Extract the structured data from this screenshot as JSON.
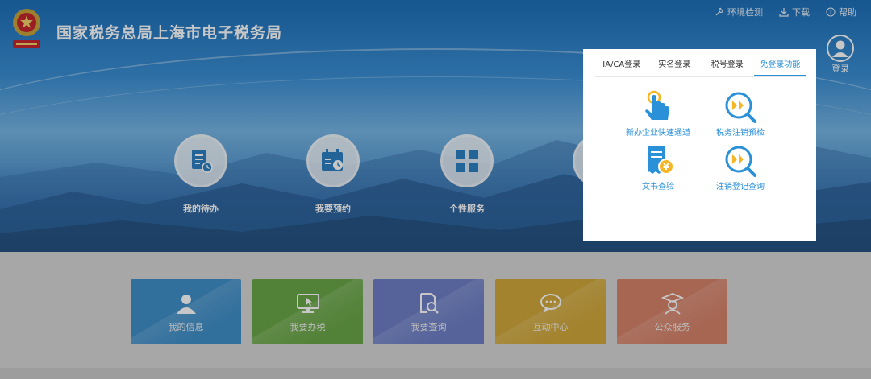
{
  "header": {
    "title": "国家税务总局上海市电子税务局",
    "logo_icon": "tax-bureau-emblem",
    "top_links": [
      {
        "label": "环境检测",
        "icon": "wrench-icon"
      },
      {
        "label": "下载",
        "icon": "download-icon"
      },
      {
        "label": "帮助",
        "icon": "help-icon"
      }
    ],
    "login_label": "登录"
  },
  "quick_entries": [
    {
      "label": "我的待办",
      "icon": "todo-doc-icon"
    },
    {
      "label": "我要预约",
      "icon": "calendar-icon"
    },
    {
      "label": "个性服务",
      "icon": "grid-icon"
    }
  ],
  "service_cards": [
    {
      "label": "我的信息",
      "icon": "user-icon",
      "color": "#3f8fc9"
    },
    {
      "label": "我要办税",
      "icon": "monitor-icon",
      "color": "#6aa747"
    },
    {
      "label": "我要查询",
      "icon": "search-doc-icon",
      "color": "#6d7fc6"
    },
    {
      "label": "互动中心",
      "icon": "chat-icon",
      "color": "#d1a83a"
    },
    {
      "label": "公众服务",
      "icon": "graduate-icon",
      "color": "#d6836a"
    }
  ],
  "login_panel": {
    "tabs": [
      {
        "label": "IA/CA登录",
        "active": false
      },
      {
        "label": "实名登录",
        "active": false
      },
      {
        "label": "税号登录",
        "active": false
      },
      {
        "label": "免登录功能",
        "active": true
      }
    ],
    "features": [
      {
        "label": "新办企业快速通道",
        "icon": "tap-hand-icon"
      },
      {
        "label": "税务注销预检",
        "icon": "magnifier-forward-icon"
      },
      {
        "label": "文书查验",
        "icon": "receipt-yen-icon"
      },
      {
        "label": "注销登记查询",
        "icon": "magnifier-forward-icon"
      }
    ]
  },
  "colors": {
    "accent": "#2a90d8",
    "hero_blue": "#2f7cc6"
  }
}
